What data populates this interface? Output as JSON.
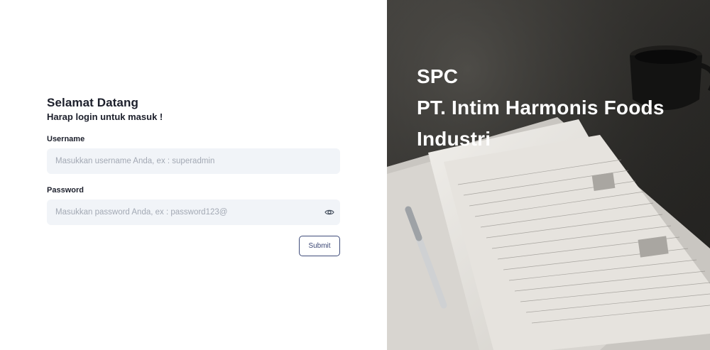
{
  "login": {
    "title": "Selamat Datang",
    "subtitle": "Harap login untuk masuk !",
    "username": {
      "label": "Username",
      "placeholder": "Masukkan username Anda, ex : superadmin",
      "value": ""
    },
    "password": {
      "label": "Password",
      "placeholder": "Masukkan password Anda, ex : password123@",
      "value": ""
    },
    "submit_label": "Submit"
  },
  "brand": {
    "line1": "SPC",
    "line2": "PT. Intim Harmonis Foods",
    "line3": "Industri"
  },
  "icons": {
    "password_toggle": "eye-icon"
  },
  "colors": {
    "input_background": "#f1f4f8",
    "submit_border": "#3f4c7a",
    "heading_text": "#1c1f2b",
    "brand_text": "#ffffff"
  }
}
